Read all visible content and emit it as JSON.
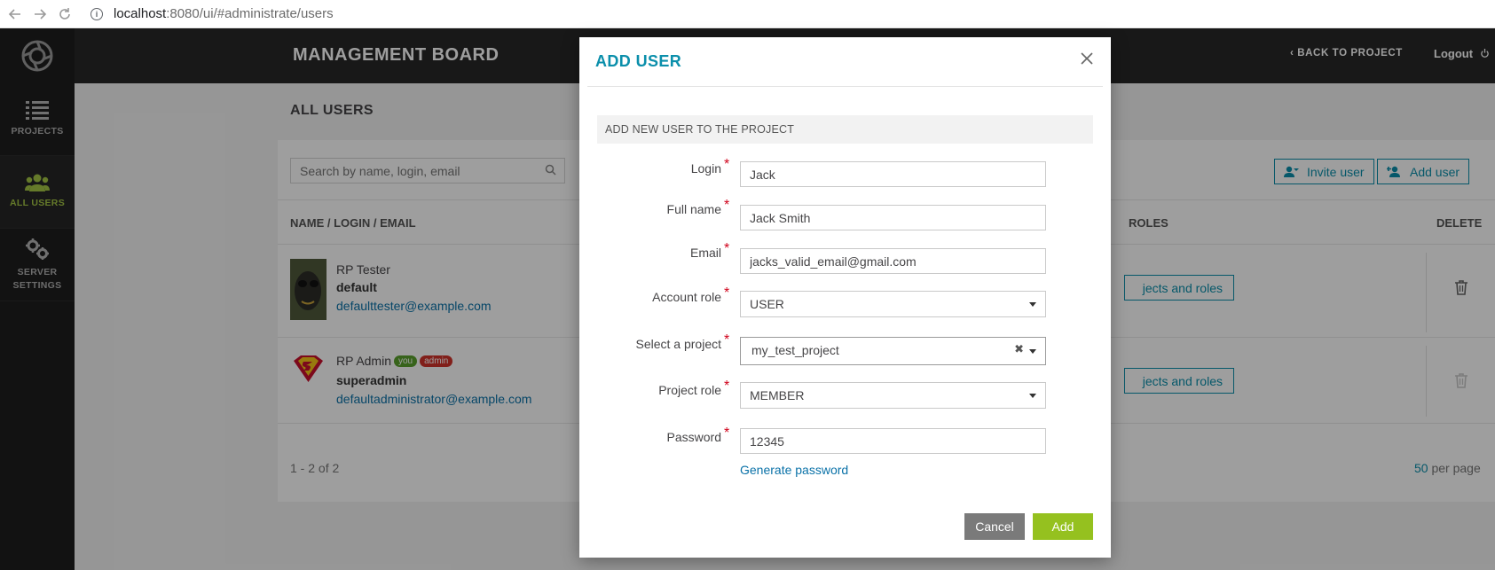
{
  "browser": {
    "url_host": "localhost",
    "url_path": ":8080/ui/#administrate/users"
  },
  "sidebar": {
    "items": [
      {
        "label": "PROJECTS",
        "icon": "list-icon"
      },
      {
        "label": "ALL USERS",
        "icon": "users-icon"
      },
      {
        "label_line1": "SERVER",
        "label_line2": "SETTINGS",
        "icon": "gears-icon"
      }
    ]
  },
  "header": {
    "title": "MANAGEMENT BOARD",
    "back_label": "BACK TO PROJECT",
    "logout_label": "Logout"
  },
  "page": {
    "title": "ALL USERS",
    "search_placeholder": "Search by name, login, email",
    "invite_label": "Invite user",
    "add_label": "Add user",
    "columns": {
      "name": "NAME / LOGIN / EMAIL",
      "roles": "ROLES",
      "delete": "DELETE"
    },
    "users": [
      {
        "name": "RP Tester",
        "login": "default",
        "email": "defaulttester@example.com",
        "projects_label": "jects and roles"
      },
      {
        "name": "RP Admin",
        "badge_you": "you",
        "badge_admin": "admin",
        "login": "superadmin",
        "email": "defaultadministrator@example.com",
        "projects_label": "jects and roles"
      }
    ],
    "pager": "1 - 2 of 2",
    "per_page_value": "50",
    "per_page_label": " per page"
  },
  "modal": {
    "title": "ADD USER",
    "subtitle": "ADD NEW USER TO THE PROJECT",
    "fields": {
      "login": {
        "label": "Login",
        "value": "Jack"
      },
      "full_name": {
        "label": "Full name",
        "value": "Jack Smith"
      },
      "email": {
        "label": "Email",
        "value": "jacks_valid_email@gmail.com"
      },
      "account_role": {
        "label": "Account role",
        "value": "USER"
      },
      "project": {
        "label": "Select a project",
        "value": "my_test_project"
      },
      "project_role": {
        "label": "Project role",
        "value": "MEMBER"
      },
      "password": {
        "label": "Password",
        "value": "12345"
      }
    },
    "required_mark": "*",
    "generate_label": "Generate password",
    "cancel_label": "Cancel",
    "add_label": "Add"
  },
  "colors": {
    "accent": "#0b8fab",
    "brand_green": "#95c11f",
    "sidebar_active": "#a3c644",
    "required": "#d0021b",
    "badge_you": "#5aa02c",
    "badge_admin": "#d0332b"
  }
}
